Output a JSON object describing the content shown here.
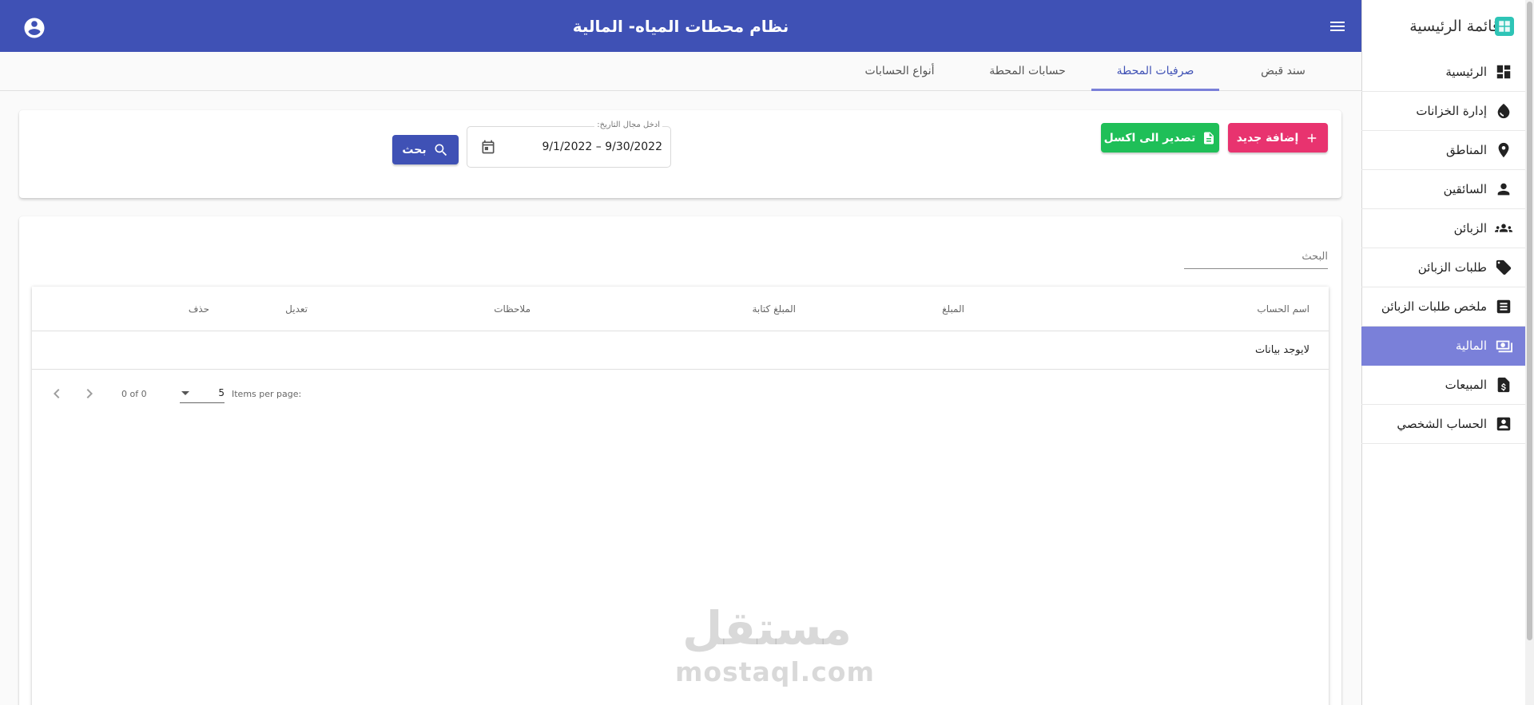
{
  "header": {
    "title": "نظام محطات المياه- المالية",
    "menu_icon": "menu-icon",
    "account_icon": "account-circle-icon",
    "color": "#3f51b5"
  },
  "sidebar": {
    "brand": "قائمة الرئيسية",
    "items": [
      {
        "label": "الرئيسية",
        "icon": "dashboard-icon",
        "active": false
      },
      {
        "label": "إدارة الخزانات",
        "icon": "water-drop-icon",
        "active": false
      },
      {
        "label": "المناطق",
        "icon": "location-pin-icon",
        "active": false
      },
      {
        "label": "السائقين",
        "icon": "person-icon",
        "active": false
      },
      {
        "label": "الزبائن",
        "icon": "group-icon",
        "active": false
      },
      {
        "label": "طلبات الزبائن",
        "icon": "tag-icon",
        "active": false
      },
      {
        "label": "ملخص طلبات الزبائن",
        "icon": "list-icon",
        "active": false
      },
      {
        "label": "المالية",
        "icon": "money-icon",
        "active": true
      },
      {
        "label": "المبيعات",
        "icon": "dollar-doc-icon",
        "active": false
      },
      {
        "label": "الحساب الشخصي",
        "icon": "account-box-icon",
        "active": false
      }
    ],
    "active_color": "#7a80d9"
  },
  "tabs": [
    {
      "label": "سند قبض",
      "active": false
    },
    {
      "label": "صرفيات المحطة",
      "active": true
    },
    {
      "label": "حسابات المحطة",
      "active": false
    },
    {
      "label": "أنواع الحسابات",
      "active": false
    }
  ],
  "filter": {
    "add_label": "إضافة جديد",
    "export_label": "تصدير الى اكسل",
    "search_label": "بحث",
    "date_label": "ادخل مجال التاريخ:",
    "date_value": "9/1/2022 – 9/30/2022",
    "add_color": "#e8336f",
    "export_color": "#1fbf58"
  },
  "table": {
    "search_placeholder": "البحث",
    "columns": [
      "اسم الحساب",
      "المبلغ",
      "المبلغ كتابة",
      "ملاحظات",
      "تعديل",
      "حذف"
    ],
    "empty_text": "لايوجد بيانات",
    "paginator": {
      "items_per_page_label": "Items per page:",
      "page_size": "5",
      "range": "0 of 0"
    }
  },
  "watermark": {
    "arabic": "مستقل",
    "latin": "mostaql.com"
  }
}
